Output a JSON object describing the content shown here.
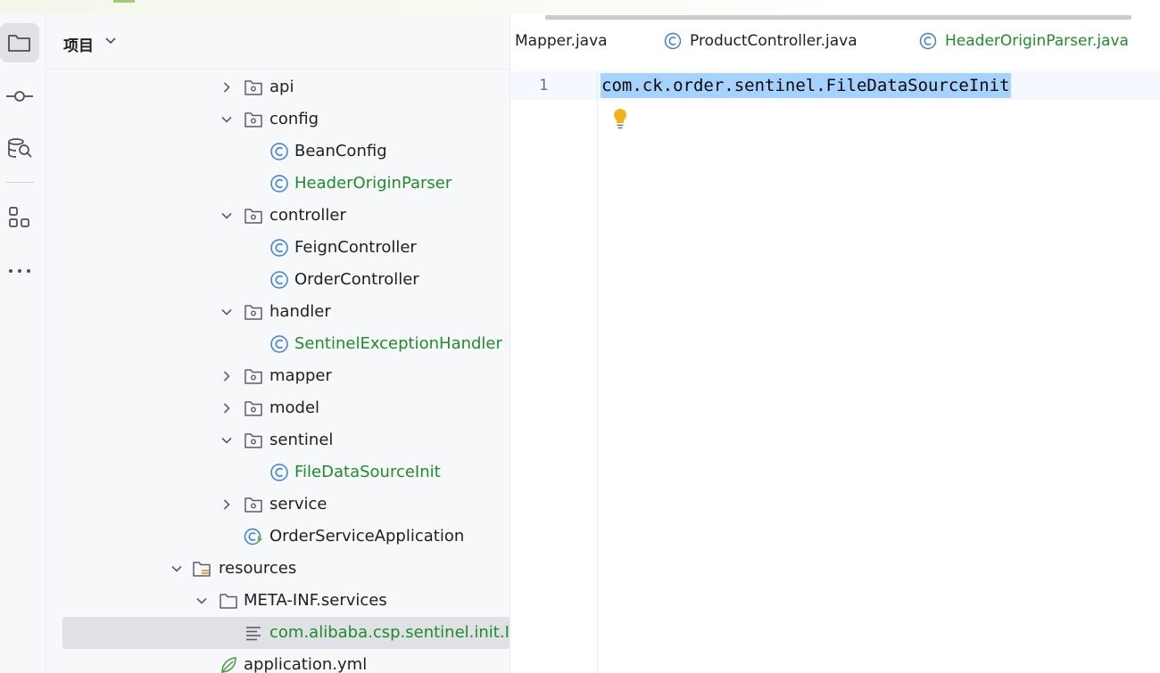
{
  "project_panel": {
    "title": "项目",
    "tree": [
      {
        "label": "api",
        "kind": "package",
        "expanded": false,
        "color": "default"
      },
      {
        "label": "config",
        "kind": "package",
        "expanded": true,
        "color": "default"
      },
      {
        "label": "BeanConfig",
        "kind": "class",
        "color": "default"
      },
      {
        "label": "HeaderOriginParser",
        "kind": "class",
        "color": "green"
      },
      {
        "label": "controller",
        "kind": "package",
        "expanded": true,
        "color": "default"
      },
      {
        "label": "FeignController",
        "kind": "class",
        "color": "default"
      },
      {
        "label": "OrderController",
        "kind": "class",
        "color": "default"
      },
      {
        "label": "handler",
        "kind": "package",
        "expanded": true,
        "color": "default"
      },
      {
        "label": "SentinelExceptionHandler",
        "kind": "class",
        "color": "green"
      },
      {
        "label": "mapper",
        "kind": "package",
        "expanded": false,
        "color": "default"
      },
      {
        "label": "model",
        "kind": "package",
        "expanded": false,
        "color": "default"
      },
      {
        "label": "sentinel",
        "kind": "package",
        "expanded": true,
        "color": "default"
      },
      {
        "label": "FileDataSourceInit",
        "kind": "class",
        "color": "green"
      },
      {
        "label": "service",
        "kind": "package",
        "expanded": false,
        "color": "default"
      },
      {
        "label": "OrderServiceApplication",
        "kind": "spring-boot-class",
        "color": "default"
      },
      {
        "label": "resources",
        "kind": "resources-folder",
        "expanded": true,
        "color": "default"
      },
      {
        "label": "META-INF.services",
        "kind": "folder",
        "expanded": true,
        "color": "default"
      },
      {
        "label": "com.alibaba.csp.sentinel.init.InitFunc",
        "kind": "text-file",
        "color": "green",
        "selected": true
      },
      {
        "label": "application.yml",
        "kind": "yaml-file",
        "color": "default"
      }
    ]
  },
  "editor": {
    "tabs": [
      {
        "label": "Mapper.java",
        "icon": "none",
        "color": "default"
      },
      {
        "label": "ProductController.java",
        "icon": "class-icon",
        "color": "default"
      },
      {
        "label": "HeaderOriginParser.java",
        "icon": "class-icon",
        "color": "green"
      }
    ],
    "line_number": "1",
    "code": "com.ck.order.sentinel.FileDataSourceInit"
  },
  "colors": {
    "green_text": "#1f8c2b",
    "selection": "#a6d2ff",
    "class_icon": "#3d7edb",
    "bulb": "#f2b21a"
  },
  "activity_bar": [
    "folder-icon",
    "commit-icon",
    "database-search-icon",
    "structure-icon",
    "more-icon"
  ]
}
